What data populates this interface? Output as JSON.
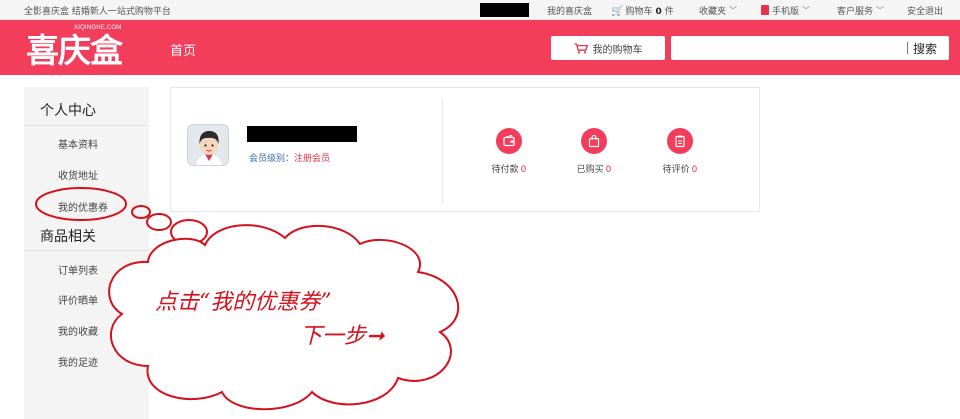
{
  "topbar": {
    "slogan": "全影喜庆盒 结婚新人一站式购物平台",
    "my_account": "我的喜庆盒",
    "cart_label": "购物车",
    "cart_count": "0",
    "cart_unit": "件",
    "favorites": "收藏夹",
    "mobile": "手机版",
    "service": "客户服务",
    "logout": "安全退出"
  },
  "header": {
    "logo_cn": "喜庆盒",
    "logo_en": "XIQINGHE.COM",
    "nav_home": "首页",
    "cart_button": "我的购物车",
    "search_button": "搜索",
    "search_value": ""
  },
  "sidebar": {
    "section1": "个人中心",
    "items1": [
      "基本资料",
      "收货地址",
      "我的优惠券"
    ],
    "section2": "商品相关",
    "items2": [
      "订单列表",
      "评价晒单",
      "我的收藏",
      "我的足迹"
    ]
  },
  "profile": {
    "level_label": "会员级别：",
    "level_value": "注册会员",
    "stats": [
      {
        "label": "待付款",
        "count": "0",
        "icon": "wallet-icon"
      },
      {
        "label": "已购买",
        "count": "0",
        "icon": "shopping-bag-icon"
      },
      {
        "label": "待评价",
        "count": "0",
        "icon": "clipboard-icon"
      }
    ]
  },
  "annotation": {
    "line1": "点击“我的优惠券”",
    "line2": "下一步➞"
  },
  "colors": {
    "brand_red": "#f23e5b",
    "annotation_red": "#d4111c"
  }
}
